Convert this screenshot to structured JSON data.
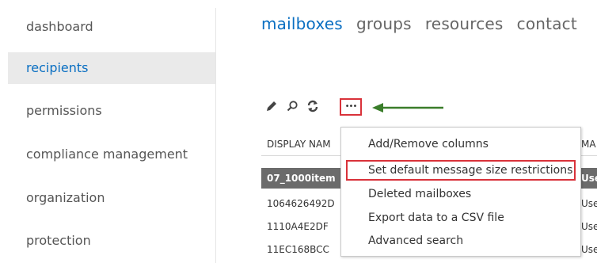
{
  "sidebar": {
    "items": [
      {
        "label": "dashboard"
      },
      {
        "label": "recipients",
        "active": true
      },
      {
        "label": "permissions"
      },
      {
        "label": "compliance management"
      },
      {
        "label": "organization"
      },
      {
        "label": "protection"
      }
    ]
  },
  "tabs": [
    {
      "label": "mailboxes",
      "active": true
    },
    {
      "label": "groups"
    },
    {
      "label": "resources"
    },
    {
      "label": "contact"
    }
  ],
  "toolbar": {
    "edit_icon": "pencil-icon",
    "search_icon": "search-icon",
    "refresh_icon": "refresh-icon",
    "more_icon": "more-options-icon",
    "more_label": "•••"
  },
  "grid": {
    "headers": [
      "DISPLAY NAM",
      "MA"
    ],
    "rows": [
      {
        "c1": "07_1000item",
        "c2": "Use",
        "selected": true
      },
      {
        "c1": "1064626492D",
        "c2": "Use"
      },
      {
        "c1": "1110A4E2DF",
        "c2": "Use"
      },
      {
        "c1": "11EC168BCC",
        "c2": "Use"
      }
    ]
  },
  "context_menu": {
    "items": [
      {
        "label": "Add/Remove columns"
      },
      {
        "label": "Set default message size restrictions",
        "highlighted": true
      },
      {
        "label": "Deleted mailboxes"
      },
      {
        "label": "Export data to a CSV file"
      },
      {
        "label": "Advanced search"
      }
    ]
  },
  "colors": {
    "accent": "#0a6fc2",
    "highlight_border": "#d9323a",
    "arrow": "#3a7d2a",
    "selected_row": "#6b6b6b"
  }
}
